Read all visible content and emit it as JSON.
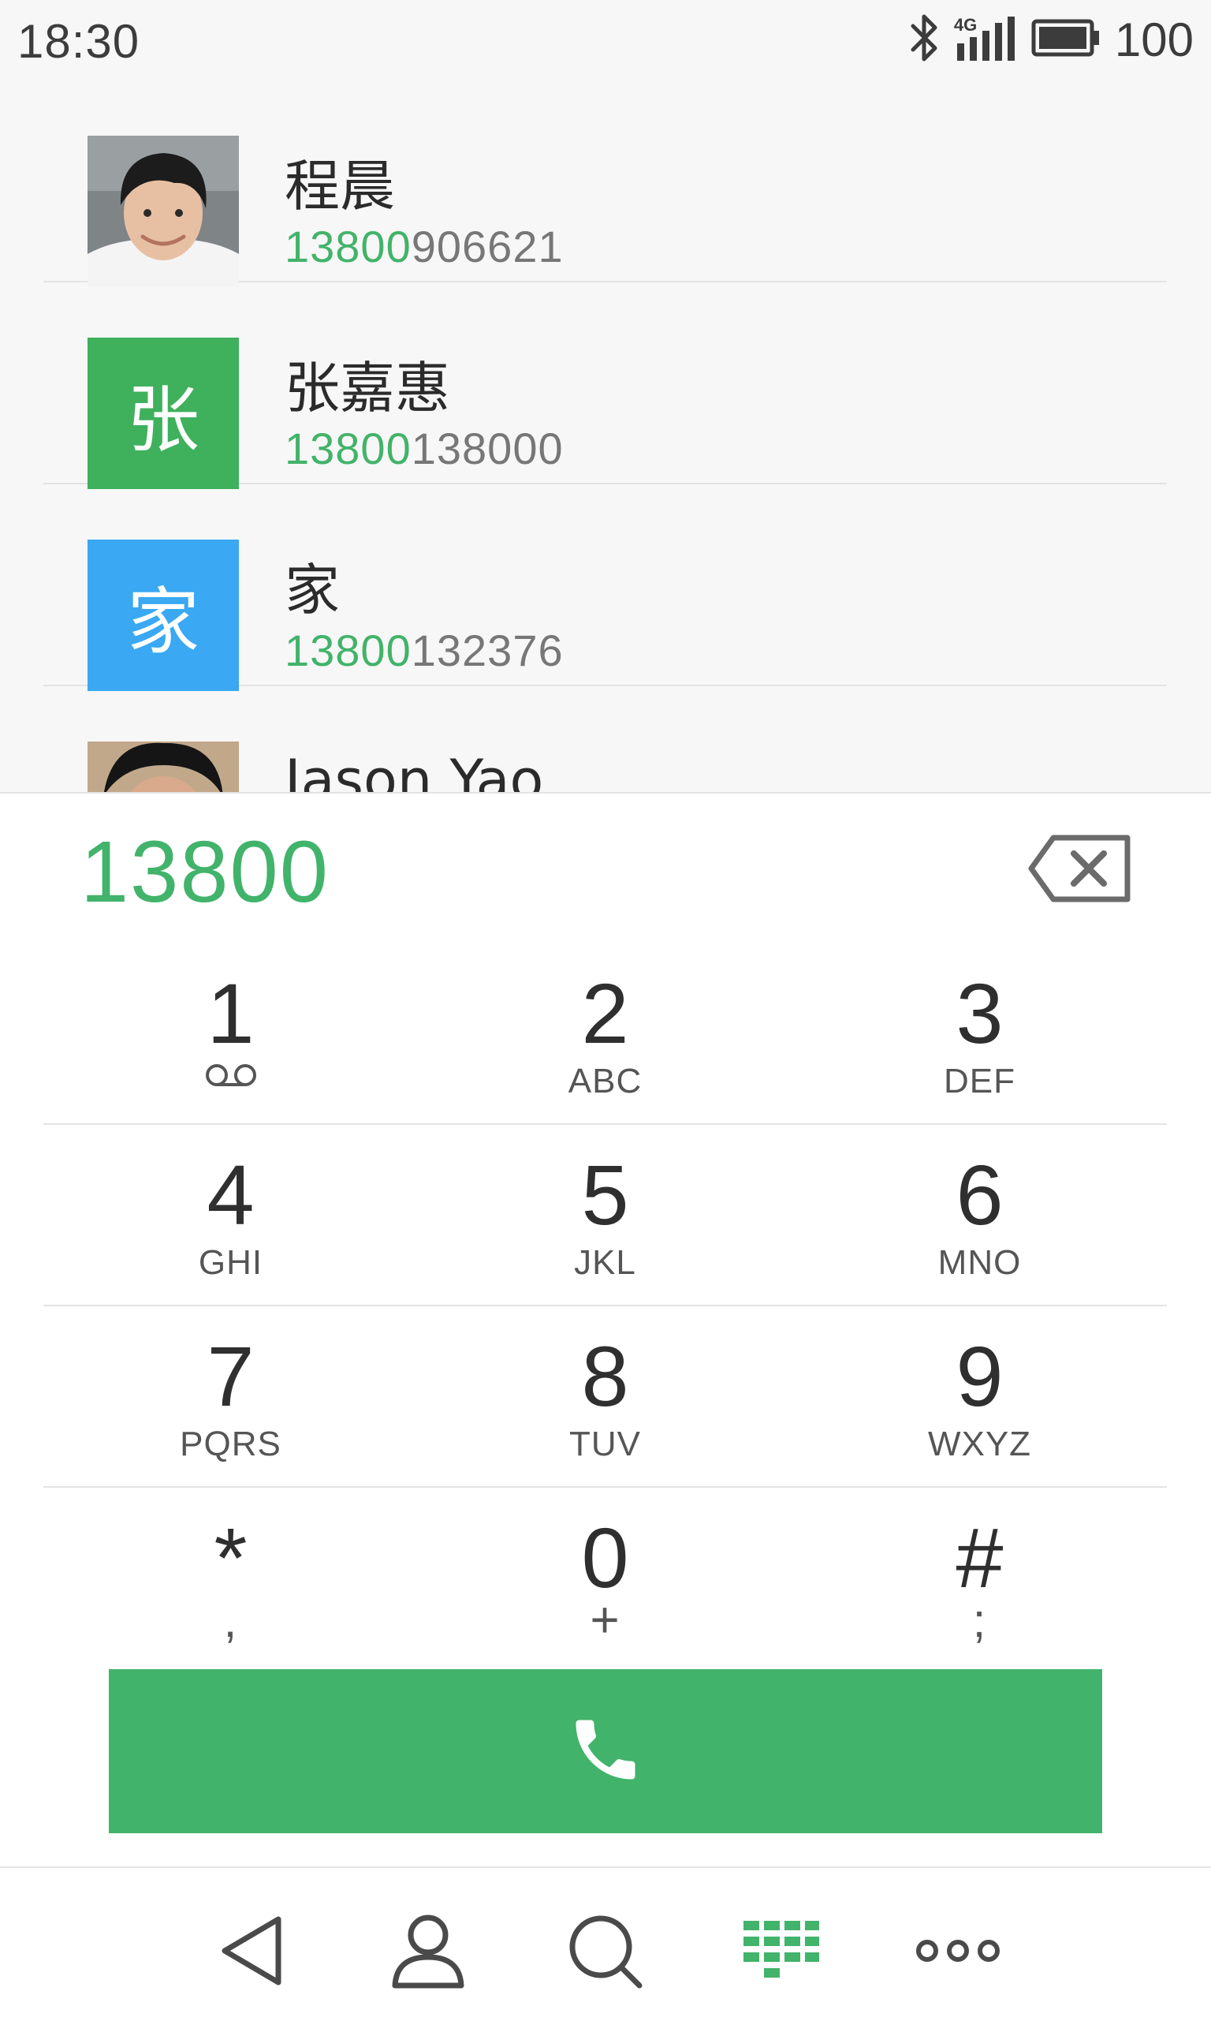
{
  "status": {
    "time": "18:30",
    "network": "4G",
    "battery": "100",
    "icons": [
      "bluetooth-icon",
      "signal-4g-icon",
      "battery-icon"
    ]
  },
  "contacts": [
    {
      "name": "程晨",
      "phone_match": "13800",
      "phone_rest": "906621",
      "avatar": "photo"
    },
    {
      "name": "张嘉惠",
      "phone_match": "13800",
      "phone_rest": "138000",
      "avatar_letter": "张",
      "avatar_color": "#3fb05c"
    },
    {
      "name": "家",
      "phone_match": "13800",
      "phone_rest": "132376",
      "avatar_letter": "家",
      "avatar_color": "#3aa8f2"
    },
    {
      "name": "Jason Yao",
      "avatar": "photo"
    }
  ],
  "dialer": {
    "input": "13800",
    "backspace_icon": "backspace-icon"
  },
  "keypad": [
    {
      "digit": "1",
      "letters": "",
      "icon": "voicemail-icon"
    },
    {
      "digit": "2",
      "letters": "ABC"
    },
    {
      "digit": "3",
      "letters": "DEF"
    },
    {
      "digit": "4",
      "letters": "GHI"
    },
    {
      "digit": "5",
      "letters": "JKL"
    },
    {
      "digit": "6",
      "letters": "MNO"
    },
    {
      "digit": "7",
      "letters": "PQRS"
    },
    {
      "digit": "8",
      "letters": "TUV"
    },
    {
      "digit": "9",
      "letters": "WXYZ"
    },
    {
      "digit": "*",
      "letters": ","
    },
    {
      "digit": "0",
      "letters": "+"
    },
    {
      "digit": "#",
      "letters": ";"
    }
  ],
  "call_button": {
    "icon": "phone-icon"
  },
  "nav": [
    {
      "name": "back",
      "icon": "back-icon"
    },
    {
      "name": "contacts",
      "icon": "person-icon"
    },
    {
      "name": "search",
      "icon": "search-icon"
    },
    {
      "name": "dialpad",
      "icon": "dialpad-icon",
      "active": true
    },
    {
      "name": "more",
      "icon": "more-icon"
    }
  ],
  "colors": {
    "accent": "#42b36a",
    "accent_blue": "#3aa8f2",
    "divider": "#e3e3e3",
    "text_primary": "#2d2d2d",
    "text_secondary": "#777777"
  }
}
